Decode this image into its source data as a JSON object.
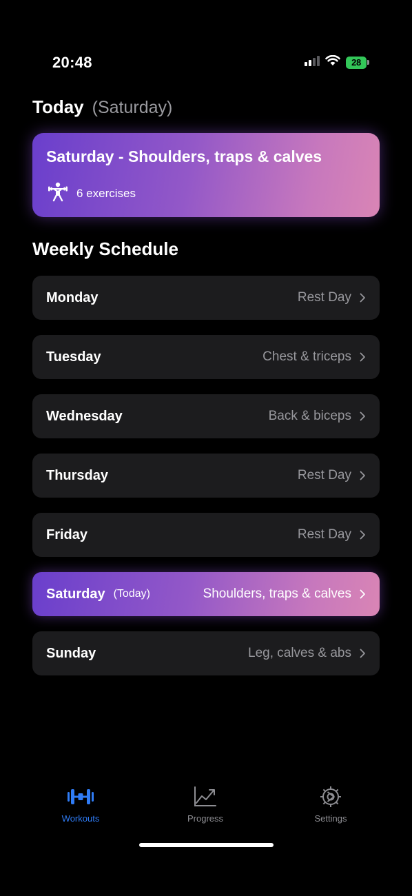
{
  "status_bar": {
    "time": "20:48",
    "battery": "28"
  },
  "today": {
    "title": "Today",
    "day": "(Saturday)",
    "card": {
      "title": "Saturday - Shoulders, traps & calves",
      "exercises": "6 exercises",
      "icon": "weightlifter-icon"
    }
  },
  "schedule": {
    "title": "Weekly Schedule",
    "rows": [
      {
        "day": "Monday",
        "tag": "",
        "workout": "Rest Day"
      },
      {
        "day": "Tuesday",
        "tag": "",
        "workout": "Chest & triceps"
      },
      {
        "day": "Wednesday",
        "tag": "",
        "workout": "Back & biceps"
      },
      {
        "day": "Thursday",
        "tag": "",
        "workout": "Rest Day"
      },
      {
        "day": "Friday",
        "tag": "",
        "workout": "Rest Day"
      },
      {
        "day": "Saturday",
        "tag": "(Today)",
        "workout": "Shoulders, traps & calves"
      },
      {
        "day": "Sunday",
        "tag": "",
        "workout": "Leg, calves & abs"
      }
    ]
  },
  "tabs": [
    {
      "label": "Workouts",
      "icon": "dumbbell-icon",
      "active": true
    },
    {
      "label": "Progress",
      "icon": "chart-icon",
      "active": false
    },
    {
      "label": "Settings",
      "icon": "gear-icon",
      "active": false
    }
  ],
  "colors": {
    "accent": "#2f7cf6",
    "gradient_start": "#6a3fcc",
    "gradient_end": "#d985b5",
    "row_background": "#1c1c1e"
  }
}
